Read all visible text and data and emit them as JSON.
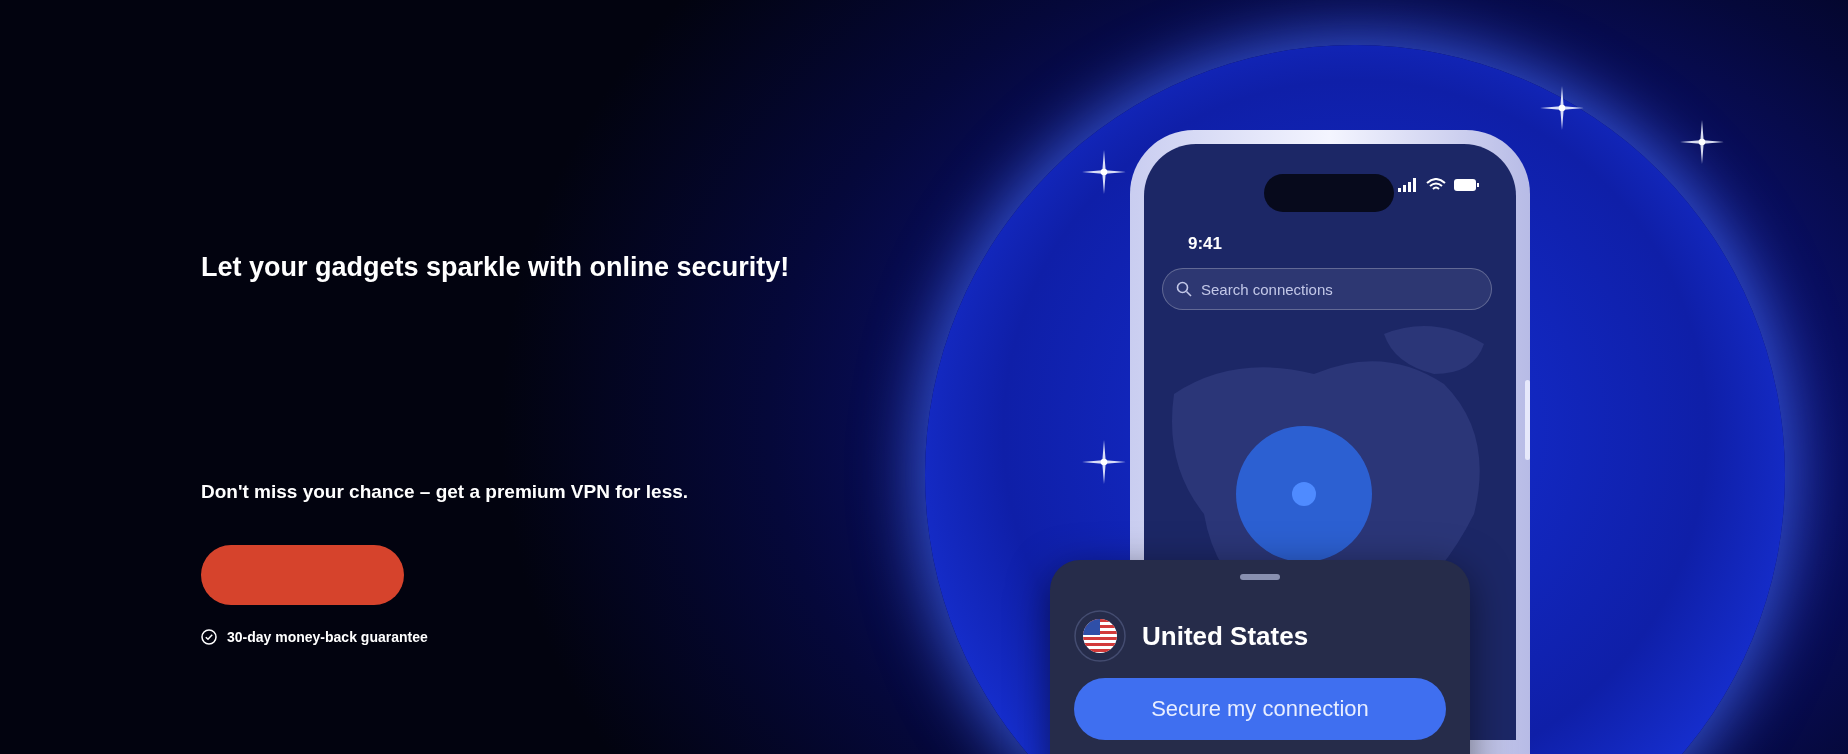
{
  "hero": {
    "headline": "Let your gadgets sparkle with online security!",
    "subtitle": "Don't miss your chance – get a premium VPN for less.",
    "guarantee": "30-day money-back guarantee"
  },
  "phone": {
    "time": "9:41",
    "search": {
      "placeholder": "Search connections"
    },
    "location_card": {
      "country": "United States",
      "button": "Secure my connection"
    }
  }
}
